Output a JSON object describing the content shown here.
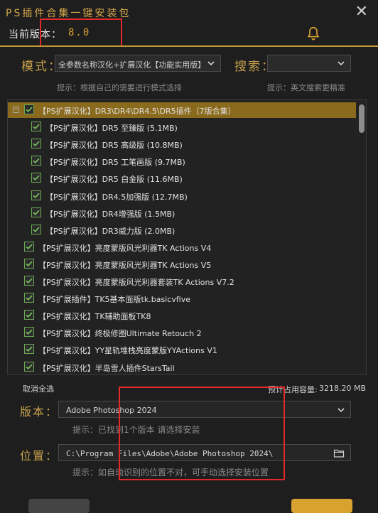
{
  "window": {
    "title": "PS插件合集一键安装包",
    "close_label": "✕"
  },
  "version": {
    "label": "当前版本：",
    "value": "8.0"
  },
  "mode": {
    "label": "模式：",
    "selected": "全参数名称汉化+扩展汉化【功能实用版】",
    "hint": "提示：根据自己的需要进行模式选择"
  },
  "search": {
    "label": "搜索：",
    "value": "",
    "hint": "提示：英文搜索更精准"
  },
  "plugins": [
    {
      "label": "【PS扩展汉化】DR3\\DR4\\DR4.5\\DR5插件（7版合集）",
      "checked": true,
      "level": 0,
      "group": true,
      "selected": true
    },
    {
      "label": "【PS扩展汉化】DR5 至臻版 (5.1MB)",
      "checked": true,
      "level": 1
    },
    {
      "label": "【PS扩展汉化】DR5 高级版 (10.8MB)",
      "checked": true,
      "level": 1
    },
    {
      "label": "【PS扩展汉化】DR5 工笔画版 (9.7MB)",
      "checked": true,
      "level": 1
    },
    {
      "label": "【PS扩展汉化】DR5 白金版 (11.6MB)",
      "checked": true,
      "level": 1
    },
    {
      "label": "【PS扩展汉化】DR4.5加强版 (12.7MB)",
      "checked": true,
      "level": 1
    },
    {
      "label": "【PS扩展汉化】DR4增强版 (1.5MB)",
      "checked": true,
      "level": 1
    },
    {
      "label": "【PS扩展汉化】DR3威力版 (2.0MB)",
      "checked": true,
      "level": 1
    },
    {
      "label": "【PS扩展汉化】亮度蒙版风光利器TK Actions V4",
      "checked": true,
      "level": 0
    },
    {
      "label": "【PS扩展汉化】亮度蒙版风光利器TK Actions V5",
      "checked": true,
      "level": 0
    },
    {
      "label": "【PS扩展汉化】亮度蒙版风光利器套装TK Actions V7.2",
      "checked": true,
      "level": 0
    },
    {
      "label": "【PS扩展插件】TK5基本面版tk.basicvfive",
      "checked": true,
      "level": 0
    },
    {
      "label": "【PS扩展汉化】TK辅助面板TK8",
      "checked": true,
      "level": 0
    },
    {
      "label": "【PS扩展汉化】终极修图Ultimate Retouch 2",
      "checked": true,
      "level": 0
    },
    {
      "label": "【PS扩展汉化】YY星轨堆栈亮度蒙版YYActions V1",
      "checked": true,
      "level": 0
    },
    {
      "label": "【PS扩展汉化】半岛雪人插件StarsTail",
      "checked": true,
      "level": 0
    }
  ],
  "bottom": {
    "deselect_all": "取消全选",
    "capacity_label": "预计占用容量:",
    "capacity_value": "3218.20 MB"
  },
  "ps_version": {
    "label": "版本：",
    "selected": "Adobe Photoshop 2024",
    "hint": "提示：已找到1个版本 请选择安装"
  },
  "location": {
    "label": "位置：",
    "path": "C:\\Program Files\\Adobe\\Adobe Photoshop 2024\\",
    "hint": "提示：如自动识别的位置不对，可手动选择安装位置"
  },
  "colors": {
    "accent": "#c49a36",
    "highlight_box": "#e02a2a",
    "check": "#6aaa52",
    "selected_row": "#8a6a1c"
  },
  "icons": {
    "bell": "bell-icon",
    "folder": "folder-icon",
    "caret": "chevron-down-icon",
    "check": "checkmark-icon"
  }
}
